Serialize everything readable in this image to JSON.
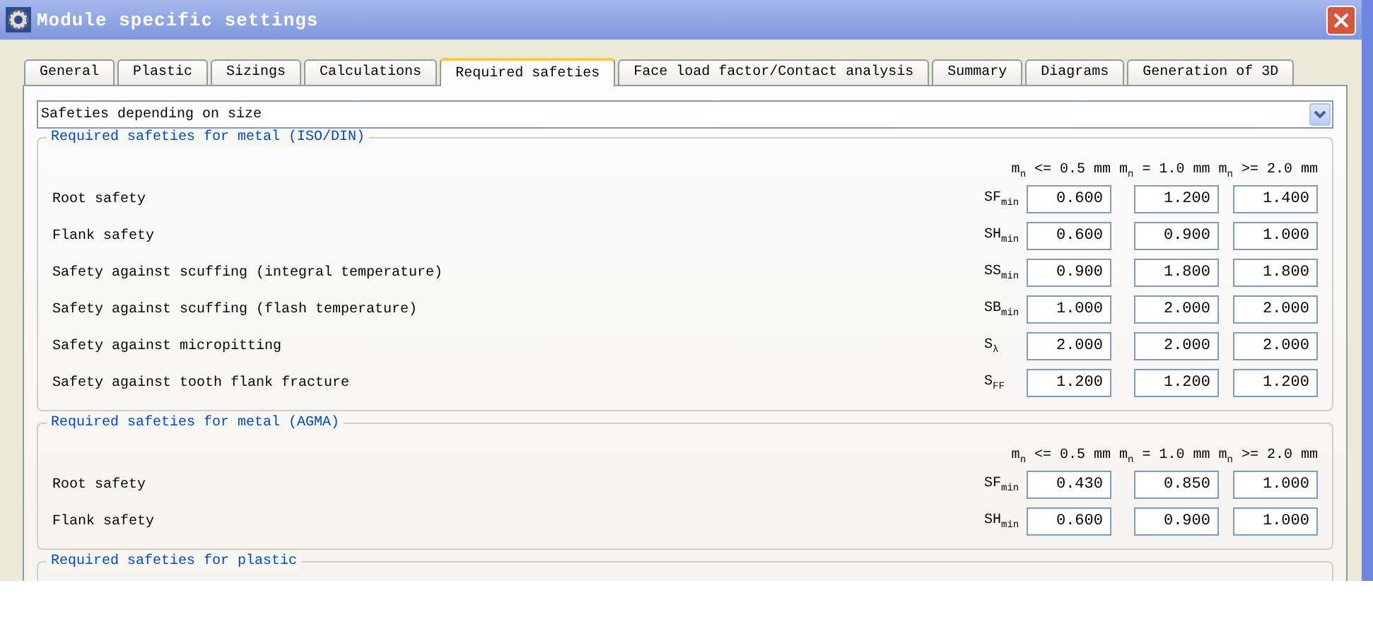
{
  "window": {
    "title": "Module specific settings"
  },
  "tabs": [
    {
      "label": "General",
      "selected": false
    },
    {
      "label": "Plastic",
      "selected": false
    },
    {
      "label": "Sizings",
      "selected": false
    },
    {
      "label": "Calculations",
      "selected": false
    },
    {
      "label": "Required safeties",
      "selected": true
    },
    {
      "label": "Face load factor/Contact analysis",
      "selected": false
    },
    {
      "label": "Summary",
      "selected": false
    },
    {
      "label": "Diagrams",
      "selected": false
    },
    {
      "label": "Generation of 3D",
      "selected": false
    }
  ],
  "dropdown": {
    "value": "Safeties depending on size"
  },
  "groups": [
    {
      "title": "Required safeties for metal (ISO/DIN)",
      "column_headers": [
        "m$_{n}$ <= 0.5 mm",
        "m$_{n}$ = 1.0 mm",
        "m$_{n}$ >= 2.0 mm"
      ],
      "rows": [
        {
          "label": "Root safety",
          "symbol": "SF$_{min}$",
          "values": [
            "0.600",
            "1.200",
            "1.400"
          ]
        },
        {
          "label": "Flank safety",
          "symbol": "SH$_{min}$",
          "values": [
            "0.600",
            "0.900",
            "1.000"
          ]
        },
        {
          "label": "Safety against scuffing (integral temperature)",
          "symbol": "SS$_{min}$",
          "values": [
            "0.900",
            "1.800",
            "1.800"
          ]
        },
        {
          "label": "Safety against scuffing (flash temperature)",
          "symbol": "SB$_{min}$",
          "values": [
            "1.000",
            "2.000",
            "2.000"
          ]
        },
        {
          "label": "Safety against micropitting",
          "symbol": "S$_{λ}$",
          "values": [
            "2.000",
            "2.000",
            "2.000"
          ]
        },
        {
          "label": "Safety against tooth flank fracture",
          "symbol": "S$_{FF}$",
          "values": [
            "1.200",
            "1.200",
            "1.200"
          ]
        }
      ]
    },
    {
      "title": "Required safeties for metal (AGMA)",
      "column_headers": [
        "m$_{n}$ <= 0.5 mm",
        "m$_{n}$ = 1.0 mm",
        "m$_{n}$ >= 2.0 mm"
      ],
      "rows": [
        {
          "label": "Root safety",
          "symbol": "SF$_{min}$",
          "values": [
            "0.430",
            "0.850",
            "1.000"
          ]
        },
        {
          "label": "Flank safety",
          "symbol": "SH$_{min}$",
          "values": [
            "0.600",
            "0.900",
            "1.000"
          ]
        }
      ]
    },
    {
      "title": "Required safeties for plastic"
    }
  ]
}
